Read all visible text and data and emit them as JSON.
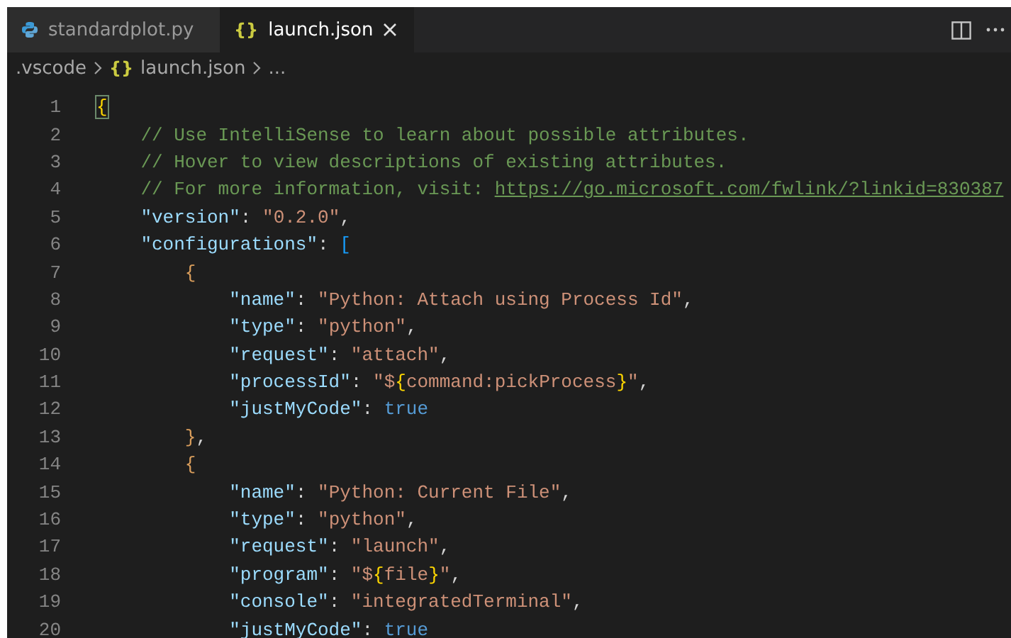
{
  "tabs": [
    {
      "label": "standardplot.py",
      "kind": "python",
      "selected": false,
      "closable": false
    },
    {
      "label": "launch.json",
      "kind": "json",
      "glyph": "{}",
      "selected": true,
      "closable": true
    }
  ],
  "breadcrumb": [
    {
      "kind": "folder",
      "label": ".vscode"
    },
    {
      "kind": "json",
      "glyph": "{}",
      "label": "launch.json"
    },
    {
      "kind": "more",
      "label": "..."
    }
  ],
  "lines": [
    {
      "number": "1",
      "tokens": [
        {
          "kind": "brace-match",
          "t": "{"
        }
      ],
      "children": [
        {
          "number": "2",
          "tokens": [
            {
              "kind": "comment",
              "t": "// Use IntelliSense to learn about possible attributes."
            }
          ]
        },
        {
          "number": "3",
          "tokens": [
            {
              "kind": "comment",
              "t": "// Hover to view descriptions of existing attributes."
            }
          ]
        },
        {
          "number": "4",
          "tokens": [
            {
              "kind": "comment",
              "t": "// For more information, visit: "
            },
            {
              "kind": "link",
              "t": "https://go.microsoft.com/fwlink/?linkid=830387"
            }
          ]
        },
        {
          "number": "5",
          "tokens": [
            {
              "kind": "key",
              "t": "\"version\""
            },
            {
              "kind": "plain",
              "t": ": "
            },
            {
              "kind": "string",
              "t": "\"0.2.0\""
            },
            {
              "kind": "plain",
              "t": ","
            }
          ]
        },
        {
          "number": "6",
          "tokens": [
            {
              "kind": "key",
              "t": "\"configurations\""
            },
            {
              "kind": "plain",
              "t": ": "
            },
            {
              "kind": "brace2",
              "t": "["
            }
          ],
          "children": [
            {
              "number": "7",
              "tokens": [
                {
                  "kind": "brace3",
                  "t": "{"
                }
              ],
              "children": [
                {
                  "number": "8",
                  "tokens": [
                    {
                      "kind": "key",
                      "t": "\"name\""
                    },
                    {
                      "kind": "plain",
                      "t": ": "
                    },
                    {
                      "kind": "string",
                      "t": "\"Python: Attach using Process Id\""
                    },
                    {
                      "kind": "plain",
                      "t": ","
                    }
                  ]
                },
                {
                  "number": "9",
                  "tokens": [
                    {
                      "kind": "key",
                      "t": "\"type\""
                    },
                    {
                      "kind": "plain",
                      "t": ": "
                    },
                    {
                      "kind": "string",
                      "t": "\"python\""
                    },
                    {
                      "kind": "plain",
                      "t": ","
                    }
                  ]
                },
                {
                  "number": "10",
                  "tokens": [
                    {
                      "kind": "key",
                      "t": "\"request\""
                    },
                    {
                      "kind": "plain",
                      "t": ": "
                    },
                    {
                      "kind": "string",
                      "t": "\"attach\""
                    },
                    {
                      "kind": "plain",
                      "t": ","
                    }
                  ]
                },
                {
                  "number": "11",
                  "tokens": [
                    {
                      "kind": "key",
                      "t": "\"processId\""
                    },
                    {
                      "kind": "plain",
                      "t": ": "
                    },
                    {
                      "kind": "string",
                      "t": "\"$"
                    },
                    {
                      "kind": "brace1",
                      "t": "{"
                    },
                    {
                      "kind": "string",
                      "t": "command:pickProcess"
                    },
                    {
                      "kind": "brace1",
                      "t": "}"
                    },
                    {
                      "kind": "string",
                      "t": "\""
                    },
                    {
                      "kind": "plain",
                      "t": ","
                    }
                  ]
                },
                {
                  "number": "12",
                  "tokens": [
                    {
                      "kind": "key",
                      "t": "\"justMyCode\""
                    },
                    {
                      "kind": "plain",
                      "t": ": "
                    },
                    {
                      "kind": "bool",
                      "t": "true"
                    }
                  ]
                }
              ]
            },
            {
              "number": "13",
              "tokens": [
                {
                  "kind": "brace3",
                  "t": "}"
                },
                {
                  "kind": "plain",
                  "t": ","
                }
              ]
            },
            {
              "number": "14",
              "tokens": [
                {
                  "kind": "brace3",
                  "t": "{"
                }
              ],
              "children": [
                {
                  "number": "15",
                  "tokens": [
                    {
                      "kind": "key",
                      "t": "\"name\""
                    },
                    {
                      "kind": "plain",
                      "t": ": "
                    },
                    {
                      "kind": "string",
                      "t": "\"Python: Current File\""
                    },
                    {
                      "kind": "plain",
                      "t": ","
                    }
                  ]
                },
                {
                  "number": "16",
                  "tokens": [
                    {
                      "kind": "key",
                      "t": "\"type\""
                    },
                    {
                      "kind": "plain",
                      "t": ": "
                    },
                    {
                      "kind": "string",
                      "t": "\"python\""
                    },
                    {
                      "kind": "plain",
                      "t": ","
                    }
                  ]
                },
                {
                  "number": "17",
                  "tokens": [
                    {
                      "kind": "key",
                      "t": "\"request\""
                    },
                    {
                      "kind": "plain",
                      "t": ": "
                    },
                    {
                      "kind": "string",
                      "t": "\"launch\""
                    },
                    {
                      "kind": "plain",
                      "t": ","
                    }
                  ]
                },
                {
                  "number": "18",
                  "tokens": [
                    {
                      "kind": "key",
                      "t": "\"program\""
                    },
                    {
                      "kind": "plain",
                      "t": ": "
                    },
                    {
                      "kind": "string",
                      "t": "\"$"
                    },
                    {
                      "kind": "brace1",
                      "t": "{"
                    },
                    {
                      "kind": "string",
                      "t": "file"
                    },
                    {
                      "kind": "brace1",
                      "t": "}"
                    },
                    {
                      "kind": "string",
                      "t": "\""
                    },
                    {
                      "kind": "plain",
                      "t": ","
                    }
                  ]
                },
                {
                  "number": "19",
                  "tokens": [
                    {
                      "kind": "key",
                      "t": "\"console\""
                    },
                    {
                      "kind": "plain",
                      "t": ": "
                    },
                    {
                      "kind": "string",
                      "t": "\"integratedTerminal\""
                    },
                    {
                      "kind": "plain",
                      "t": ","
                    }
                  ]
                },
                {
                  "number": "20",
                  "tokens": [
                    {
                      "kind": "key",
                      "t": "\"justMyCode\""
                    },
                    {
                      "kind": "plain",
                      "t": ": "
                    },
                    {
                      "kind": "bool",
                      "t": "true"
                    }
                  ]
                }
              ]
            }
          ]
        }
      ]
    }
  ]
}
